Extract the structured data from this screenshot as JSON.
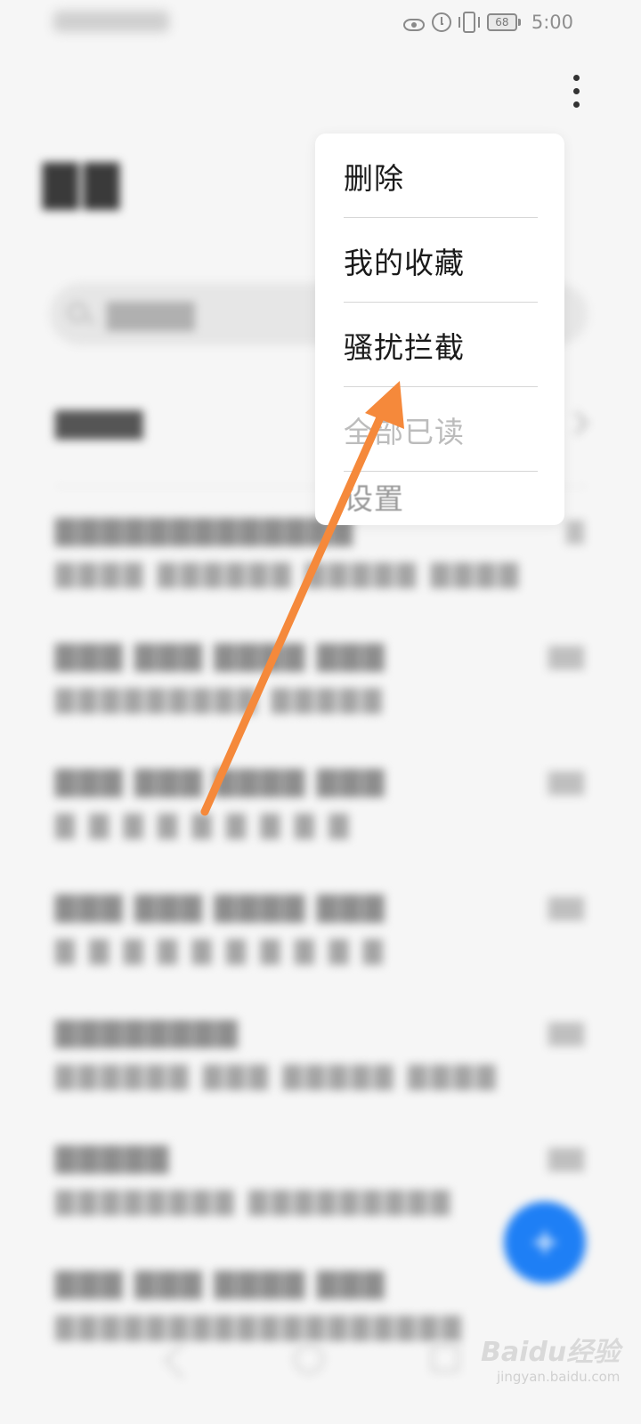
{
  "status_bar": {
    "battery": "68",
    "time": "5:00",
    "icons": [
      "eye-icon",
      "alarm-icon",
      "vibrate-icon",
      "battery-icon"
    ]
  },
  "menu": {
    "items": [
      {
        "label": "删除"
      },
      {
        "label": "我的收藏"
      },
      {
        "label": "骚扰拦截"
      },
      {
        "label": "全部已读"
      },
      {
        "label": "设置"
      }
    ]
  },
  "colors": {
    "fab": "#1e7ff5",
    "arrow": "#f5893b",
    "menu_background": "#ffffff"
  },
  "watermark": {
    "logo": "Baidu经验",
    "sub": "jingyan.baidu.com"
  }
}
